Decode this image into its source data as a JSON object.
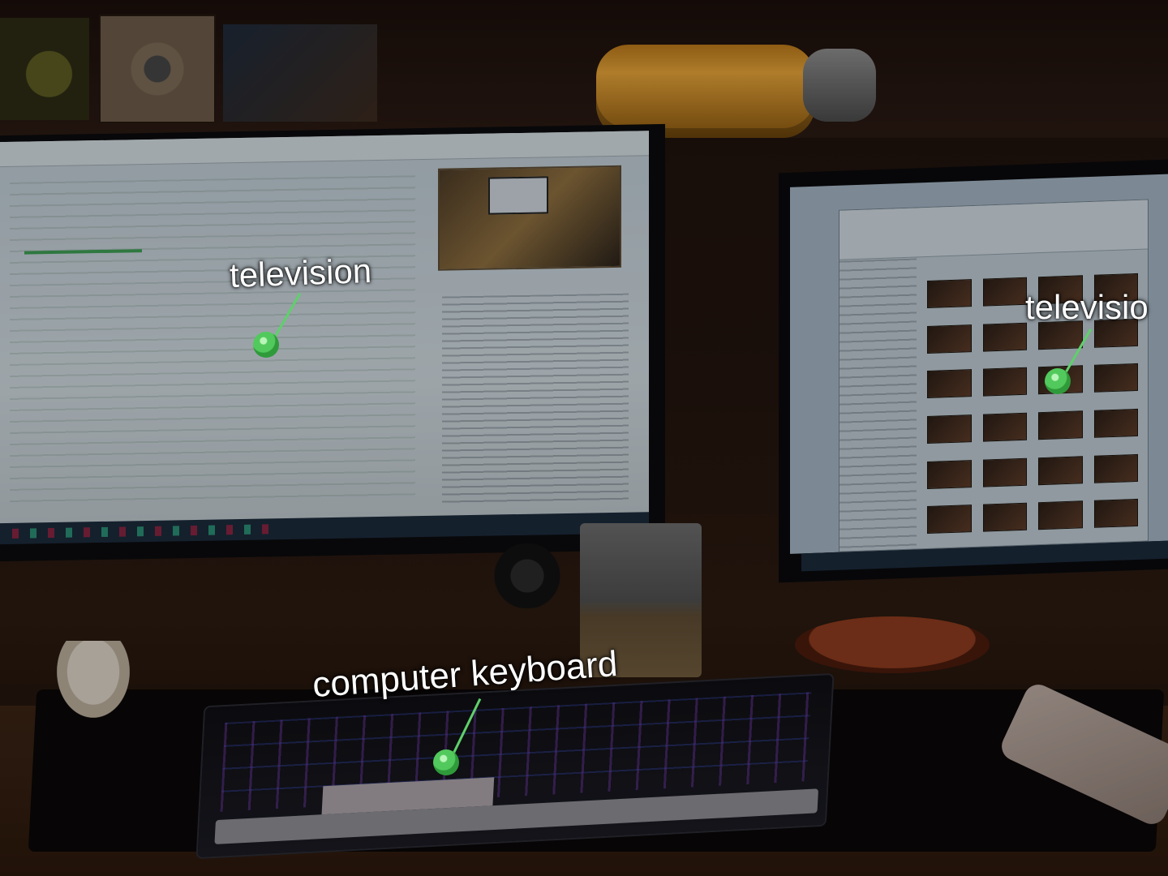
{
  "annotations": [
    {
      "id": "tv-left",
      "label": "television",
      "dot_color": "#52c95c",
      "text_color": "#ffffff"
    },
    {
      "id": "tv-right",
      "label": "televisio",
      "dot_color": "#52c95c",
      "text_color": "#ffffff"
    },
    {
      "id": "keyboard",
      "label": "computer keyboard",
      "dot_color": "#52c95c",
      "text_color": "#ffffff"
    }
  ],
  "scene": {
    "objects": [
      "left-monitor",
      "right-monitor",
      "computer-keyboard",
      "phone",
      "storage-box",
      "unicorn-figure",
      "orange-cylinder"
    ]
  }
}
